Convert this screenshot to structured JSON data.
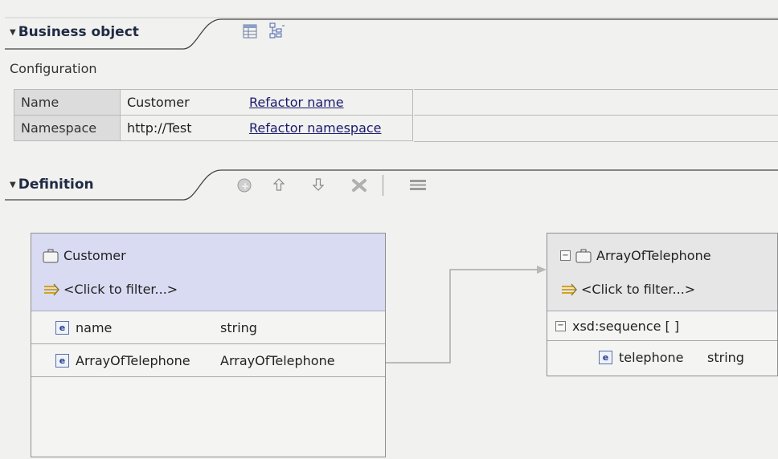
{
  "business_object": {
    "title": "Business object",
    "configuration_label": "Configuration",
    "rows": [
      {
        "key": "Name",
        "value": "Customer",
        "link": "Refactor name"
      },
      {
        "key": "Namespace",
        "value": "http://Test",
        "link": "Refactor namespace"
      }
    ],
    "toolbar": [
      "table-view-icon",
      "tree-view-icon"
    ]
  },
  "definition": {
    "title": "Definition",
    "toolbar": [
      "add-field-icon",
      "move-up-icon",
      "move-down-icon",
      "delete-icon",
      "layout-icon"
    ],
    "customer_box": {
      "title": "Customer",
      "filter": "<Click to filter...>",
      "fields": [
        {
          "name": "name",
          "type": "string"
        },
        {
          "name": "ArrayOfTelephone",
          "type": "ArrayOfTelephone"
        }
      ]
    },
    "array_box": {
      "title": "ArrayOfTelephone",
      "filter": "<Click to filter...>",
      "sequence": "xsd:sequence [ ]",
      "fields": [
        {
          "name": "telephone",
          "type": "string"
        }
      ]
    }
  },
  "colors": {
    "header_title": "#1f2a44",
    "box_header": "#d9dbf2",
    "link": "#1a1a6e"
  }
}
